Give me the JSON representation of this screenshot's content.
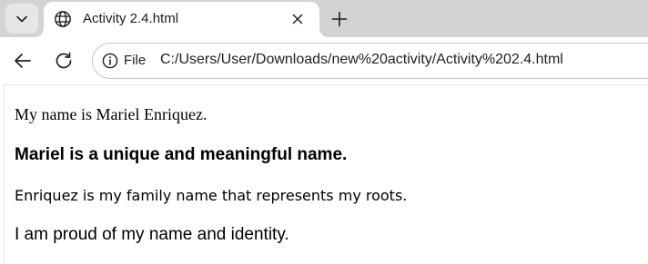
{
  "browser": {
    "tab": {
      "title": "Activity 2.4.html",
      "favicon": "globe-icon"
    },
    "toolbar": {
      "scheme_label": "File",
      "url": "C:/Users/User/Downloads/new%20activity/Activity%202.4.html"
    },
    "icons": {
      "tab_search": "chevron-down-icon",
      "close_tab": "close-icon",
      "new_tab": "plus-icon",
      "back": "back-arrow-icon",
      "reload": "reload-icon",
      "site_info": "info-icon"
    },
    "colors": {
      "tabstrip": "#d3d3d3",
      "active_tab": "#ffffff",
      "text": "#1f1f1f"
    }
  },
  "page": {
    "line1": "My name is Mariel Enriquez.",
    "heading": "Mariel is a unique and meaningful name.",
    "line2": "Enriquez is my family name that represents my roots.",
    "line3": "I am proud of my name and identity."
  }
}
